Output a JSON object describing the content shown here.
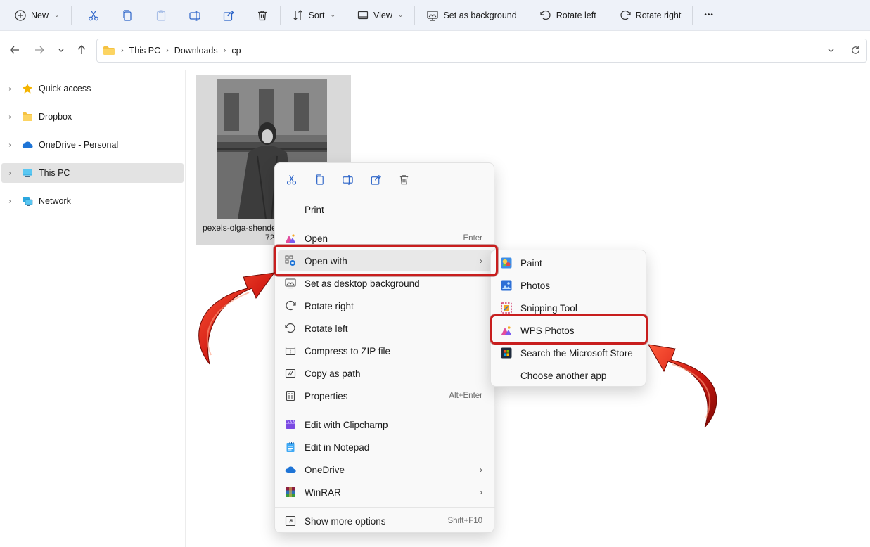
{
  "toolbar": {
    "new_label": "New",
    "sort_label": "Sort",
    "view_label": "View",
    "set_bg_label": "Set as background",
    "rotate_left_label": "Rotate left",
    "rotate_right_label": "Rotate right",
    "more_label": "•••"
  },
  "address": {
    "crumbs": [
      "This PC",
      "Downloads",
      "cp"
    ]
  },
  "sidebar": {
    "items": [
      {
        "label": "Quick access",
        "icon": "star-icon"
      },
      {
        "label": "Dropbox",
        "icon": "folder-icon"
      },
      {
        "label": "OneDrive - Personal",
        "icon": "cloud-icon"
      },
      {
        "label": "This PC",
        "icon": "computer-icon",
        "selected": true
      },
      {
        "label": "Network",
        "icon": "network-icon"
      }
    ]
  },
  "file": {
    "name_line1": "pexels-olga-shende",
    "name_line2": "72"
  },
  "context_menu": {
    "print": "Print",
    "open": "Open",
    "open_shortcut": "Enter",
    "open_with": "Open with",
    "set_desktop_bg": "Set as desktop background",
    "rotate_right": "Rotate right",
    "rotate_left": "Rotate left",
    "compress_zip": "Compress to ZIP file",
    "copy_as_path": "Copy as path",
    "properties": "Properties",
    "properties_shortcut": "Alt+Enter",
    "edit_clipchamp": "Edit with Clipchamp",
    "edit_notepad": "Edit in Notepad",
    "onedrive": "OneDrive",
    "winrar": "WinRAR",
    "show_more": "Show more options",
    "show_more_shortcut": "Shift+F10",
    "arrow_glyph": "›"
  },
  "open_with_menu": {
    "paint": "Paint",
    "photos": "Photos",
    "snipping_tool": "Snipping Tool",
    "wps_photos": "WPS Photos",
    "ms_store": "Search the Microsoft Store",
    "choose_app": "Choose another app"
  },
  "colors": {
    "highlight": "#c81e1e",
    "toolbar_bg": "#eef2f9",
    "menu_bg": "#f9f9f9"
  }
}
